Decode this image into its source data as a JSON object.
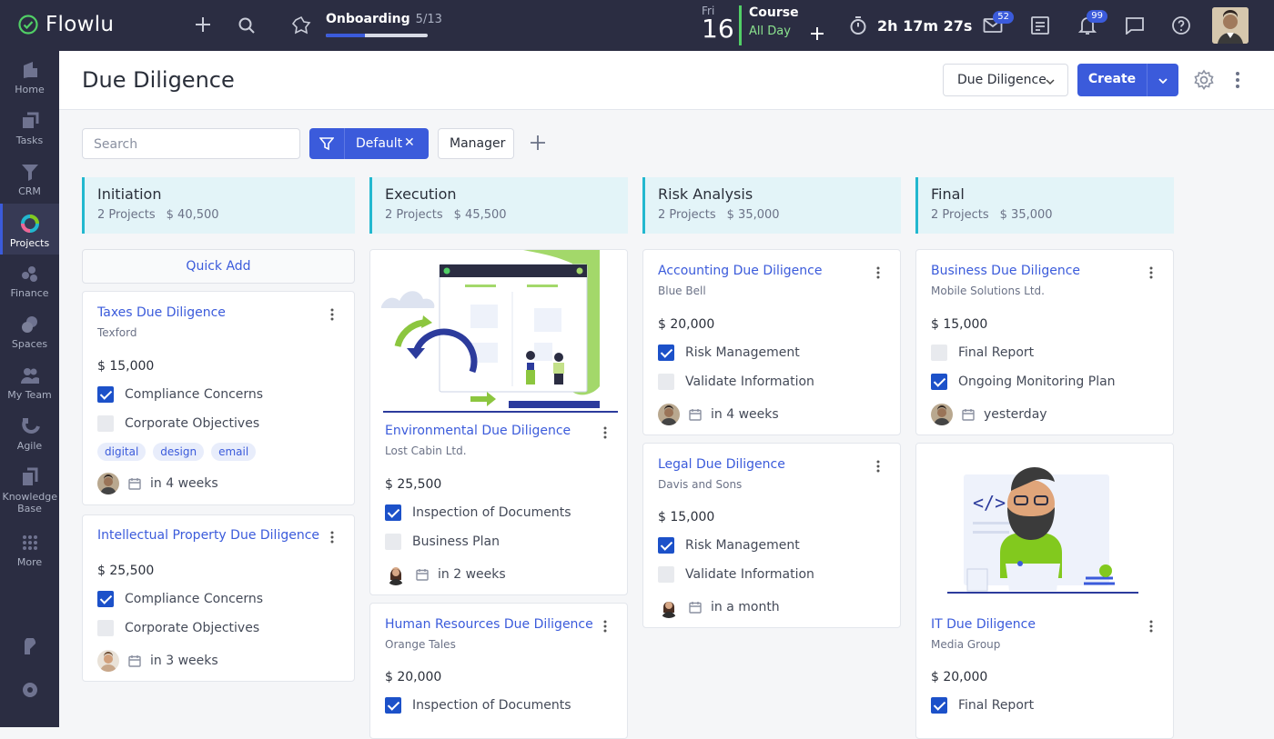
{
  "app": {
    "name": "Flowlu"
  },
  "topbar": {
    "onboarding": {
      "title": "Onboarding",
      "count": "5/13",
      "progress": 0.38
    },
    "date": {
      "day": "Fri",
      "num": "16"
    },
    "event": {
      "title": "Course",
      "sub": "All Day"
    },
    "timer": "2h 17m 27s",
    "mail_badge": "52",
    "notif_badge": "99"
  },
  "sidebar": {
    "items": [
      {
        "label": "Home"
      },
      {
        "label": "Tasks"
      },
      {
        "label": "CRM"
      },
      {
        "label": "Projects"
      },
      {
        "label": "Finance"
      },
      {
        "label": "Spaces"
      },
      {
        "label": "My Team"
      },
      {
        "label": "Agile"
      },
      {
        "label": "Knowledge Base"
      },
      {
        "label": "More"
      }
    ]
  },
  "header": {
    "title": "Due Diligence",
    "pipeline": "Due Diligence",
    "create": "Create"
  },
  "toolbar": {
    "search_placeholder": "Search",
    "filter": "Default",
    "manager": "Manager"
  },
  "columns": [
    {
      "title": "Initiation",
      "projects": "2 Projects",
      "amount": "$ 40,500"
    },
    {
      "title": "Execution",
      "projects": "2 Projects",
      "amount": "$ 45,500"
    },
    {
      "title": "Risk Analysis",
      "projects": "2 Projects",
      "amount": "$ 35,000"
    },
    {
      "title": "Final",
      "projects": "2 Projects",
      "amount": "$ 35,000"
    }
  ],
  "quick_add": "Quick Add",
  "cards": {
    "taxes": {
      "title": "Taxes Due Diligence",
      "client": "Texford",
      "amount": "$ 15,000",
      "tasks": [
        "Compliance Concerns",
        "Corporate Objectives"
      ],
      "tags": [
        "digital",
        "design",
        "email"
      ],
      "due": "in 4 weeks"
    },
    "ip": {
      "title": "Intellectual Property Due Diligence",
      "amount": "$ 25,500",
      "tasks": [
        "Compliance Concerns",
        "Corporate Objectives"
      ],
      "due": "in 3 weeks"
    },
    "env": {
      "title": "Environmental Due Diligence",
      "client": "Lost Cabin Ltd.",
      "amount": "$ 25,500",
      "tasks": [
        "Inspection of Documents",
        "Business Plan"
      ],
      "due": "in 2 weeks"
    },
    "hr": {
      "title": "Human Resources Due Diligence",
      "client": "Orange Tales",
      "amount": "$ 20,000",
      "tasks": [
        "Inspection of Documents"
      ]
    },
    "acc": {
      "title": "Accounting Due Diligence",
      "client": "Blue Bell",
      "amount": "$ 20,000",
      "tasks": [
        "Risk Management",
        "Validate Information"
      ],
      "due": "in 4 weeks"
    },
    "legal": {
      "title": "Legal Due Diligence",
      "client": "Davis and Sons",
      "amount": "$ 15,000",
      "tasks": [
        "Risk Management",
        "Validate Information"
      ],
      "due": "in a month"
    },
    "bus": {
      "title": "Business Due Diligence",
      "client": "Mobile Solutions Ltd.",
      "amount": "$ 15,000",
      "tasks": [
        "Final Report",
        "Ongoing Monitoring Plan"
      ],
      "due": "yesterday"
    },
    "it": {
      "title": "IT Due Diligence",
      "client": "Media Group",
      "amount": "$ 20,000",
      "tasks": [
        "Final Report"
      ]
    }
  }
}
